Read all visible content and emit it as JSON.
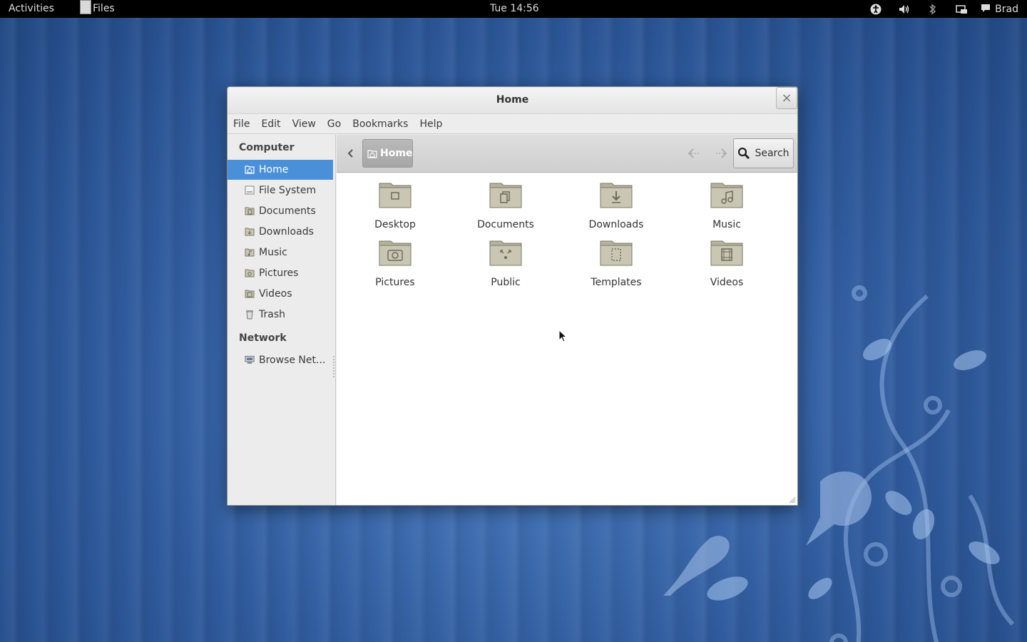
{
  "panel": {
    "activities": "Activities",
    "app_name": "Files",
    "clock": "Tue 14:56",
    "user": "Brad",
    "tray_icons": [
      "accessibility-icon",
      "volume-icon",
      "bluetooth-icon",
      "display-icon",
      "chat-icon"
    ]
  },
  "window": {
    "title": "Home",
    "close_glyph": "×",
    "menu": [
      "File",
      "Edit",
      "View",
      "Go",
      "Bookmarks",
      "Help"
    ]
  },
  "sidebar": {
    "computer_heading": "Computer",
    "network_heading": "Network",
    "items": [
      {
        "label": "Home",
        "icon": "home-folder-icon",
        "selected": true
      },
      {
        "label": "File System",
        "icon": "drive-icon"
      },
      {
        "label": "Documents",
        "icon": "documents-folder-icon"
      },
      {
        "label": "Downloads",
        "icon": "downloads-folder-icon"
      },
      {
        "label": "Music",
        "icon": "music-folder-icon"
      },
      {
        "label": "Pictures",
        "icon": "pictures-folder-icon"
      },
      {
        "label": "Videos",
        "icon": "videos-folder-icon"
      },
      {
        "label": "Trash",
        "icon": "trash-icon"
      }
    ],
    "network_items": [
      {
        "label": "Browse Net...",
        "icon": "network-icon"
      }
    ]
  },
  "toolbar": {
    "crumb": "Home",
    "search_label": "Search"
  },
  "files": [
    {
      "label": "Desktop",
      "icon": "desktop-folder-icon"
    },
    {
      "label": "Documents",
      "icon": "documents-folder-icon"
    },
    {
      "label": "Downloads",
      "icon": "downloads-folder-icon"
    },
    {
      "label": "Music",
      "icon": "music-folder-icon"
    },
    {
      "label": "Pictures",
      "icon": "pictures-folder-icon"
    },
    {
      "label": "Public",
      "icon": "public-folder-icon"
    },
    {
      "label": "Templates",
      "icon": "templates-folder-icon"
    },
    {
      "label": "Videos",
      "icon": "videos-folder-icon"
    }
  ],
  "colors": {
    "selection": "#4a90d9",
    "wallpaper": "#2f5b9d",
    "folder": "#b5b29e"
  }
}
